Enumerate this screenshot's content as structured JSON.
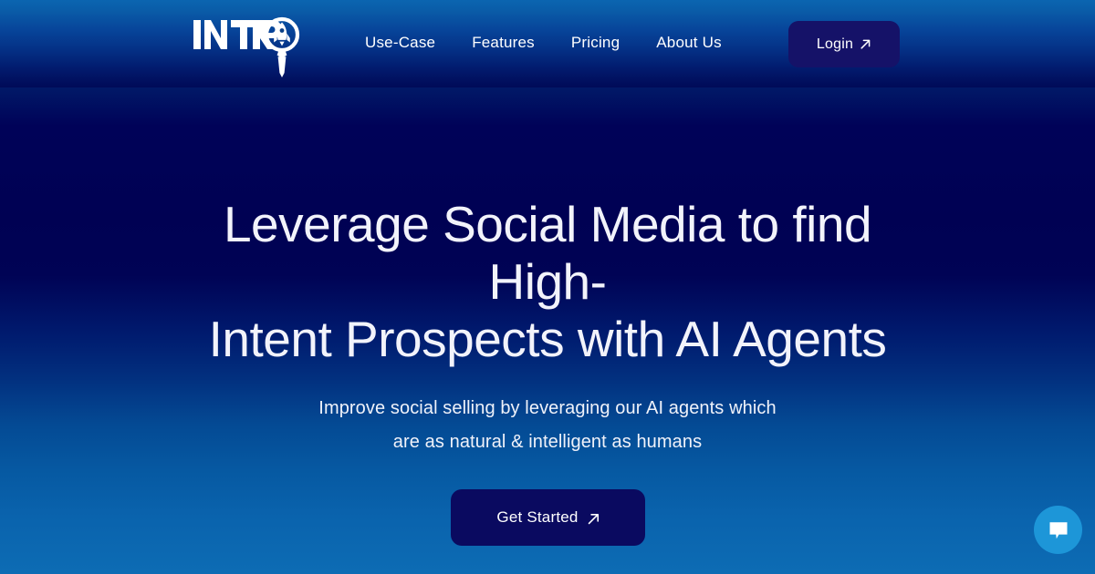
{
  "brand": {
    "logo_text": "INTR",
    "logo_icon": "rocket-in-circle-with-tie-icon",
    "name": "INTRO"
  },
  "nav": {
    "items": [
      {
        "label": "Use-Case"
      },
      {
        "label": "Features"
      },
      {
        "label": "Pricing"
      },
      {
        "label": "About Us"
      }
    ],
    "login": {
      "label": "Login",
      "icon": "arrow-up-right-icon"
    }
  },
  "hero": {
    "title_lines": [
      "Leverage Social Media to find High-",
      "Intent Prospects with AI Agents"
    ],
    "subtitle_lines": [
      "Improve social selling by leveraging our AI agents which",
      "are as natural & intelligent as humans"
    ],
    "cta": {
      "label": "Get Started",
      "icon": "arrow-up-right-icon"
    }
  },
  "chat": {
    "icon": "chat-bubble-icon",
    "label": "Open chat"
  },
  "colors": {
    "gradient_top": "#0a63ae",
    "gradient_mid": "#000258",
    "gradient_bottom": "#0d6cb4",
    "button_navy": "#0a0a60",
    "login_navy": "#151268",
    "chat_blue": "#1d96d8",
    "text_white": "#ffffff"
  }
}
